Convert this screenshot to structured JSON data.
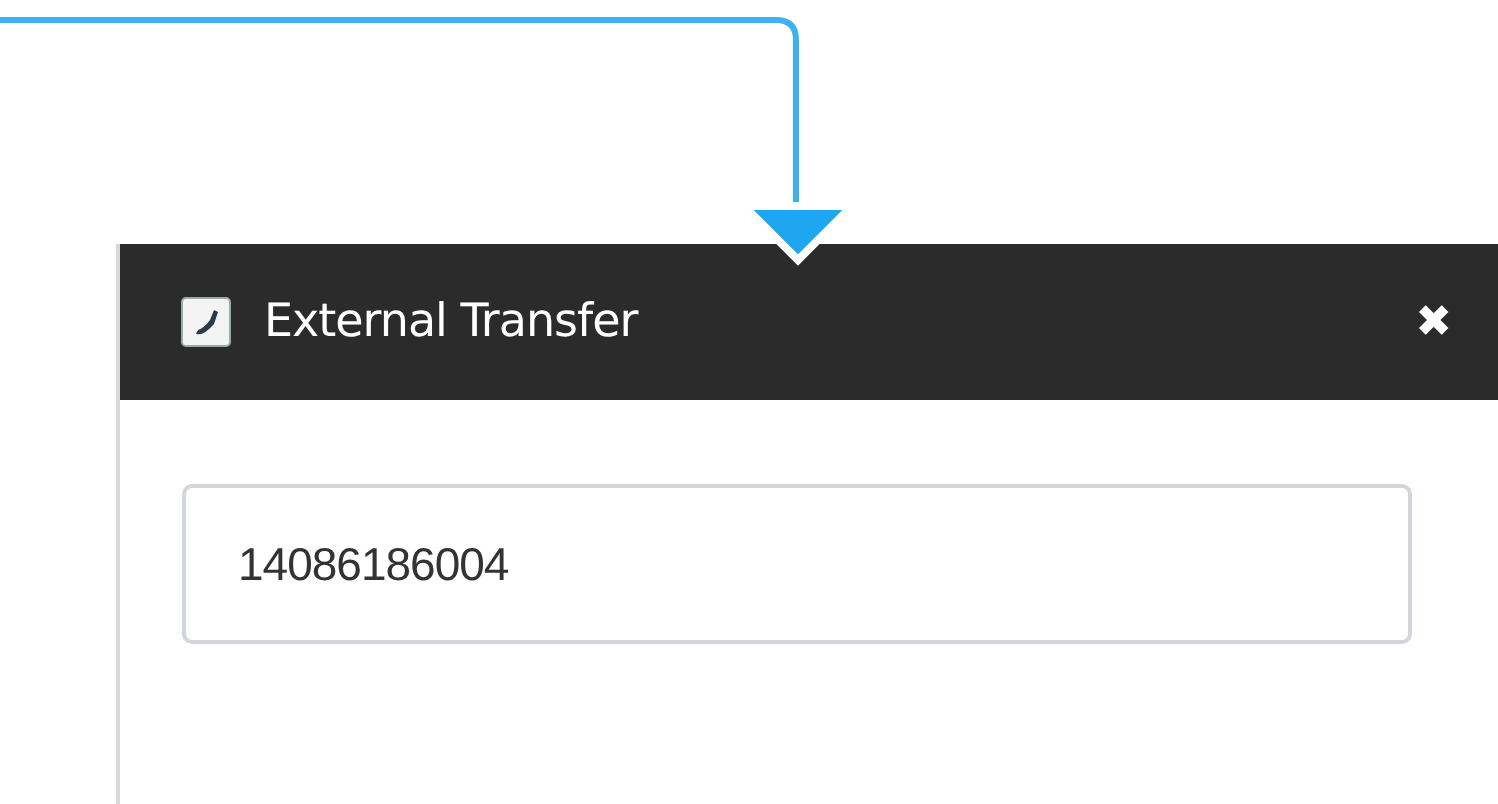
{
  "dialog": {
    "title": "External Transfer",
    "close": "✖",
    "number_field": {
      "value": "14086186004"
    }
  }
}
